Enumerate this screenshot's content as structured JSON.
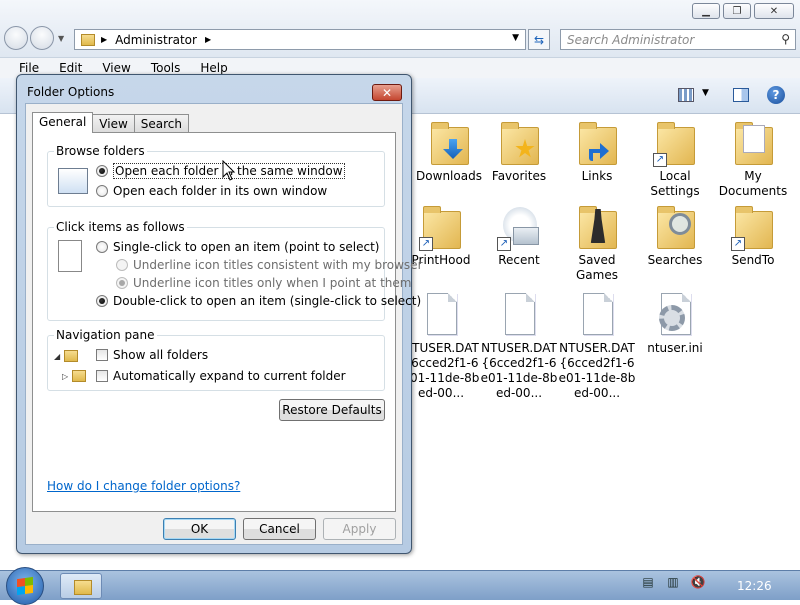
{
  "window": {
    "minimize_icon": "minimize-icon",
    "maximize_icon": "restore-icon",
    "close_icon": "close-icon"
  },
  "address_bar": {
    "path": "Administrator",
    "search_placeholder": "Search Administrator"
  },
  "menu": {
    "items": [
      "File",
      "Edit",
      "View",
      "Tools",
      "Help"
    ]
  },
  "files": [
    {
      "label": "Downloads",
      "type": "folder"
    },
    {
      "label": "Favorites",
      "type": "folder"
    },
    {
      "label": "Links",
      "type": "folder"
    },
    {
      "label": "Local Settings",
      "type": "folder-shortcut"
    },
    {
      "label": "My Documents",
      "type": "folder"
    },
    {
      "label": "PrintHood",
      "type": "folder-shortcut"
    },
    {
      "label": "Recent",
      "type": "shortcut"
    },
    {
      "label": "Saved Games",
      "type": "folder"
    },
    {
      "label": "Searches",
      "type": "folder"
    },
    {
      "label": "SendTo",
      "type": "folder-shortcut"
    },
    {
      "label": "NTUSER.DAT{6cced2f1-6e01-11de-8bed-00...",
      "type": "file"
    },
    {
      "label": "NTUSER.DAT{6cced2f1-6e01-11de-8bed-00...",
      "type": "file"
    },
    {
      "label": "NTUSER.DAT{6cced2f1-6e01-11de-8bed-00...",
      "type": "file"
    },
    {
      "label": "ntuser.ini",
      "type": "settings-file"
    }
  ],
  "dialog": {
    "title": "Folder Options",
    "tabs": [
      "General",
      "View",
      "Search"
    ],
    "browse_folders": {
      "title": "Browse folders",
      "opt_same": "Open each folder in the same window",
      "opt_own": "Open each folder in its own window"
    },
    "click_items": {
      "title": "Click items as follows",
      "single": "Single-click to open an item (point to select)",
      "underline_browser": "Underline icon titles consistent with my browser",
      "underline_point": "Underline icon titles only when I point at them",
      "double": "Double-click to open an item (single-click to select)"
    },
    "navigation_pane": {
      "title": "Navigation pane",
      "show_all": "Show all folders",
      "auto_expand": "Automatically expand to current folder"
    },
    "restore_defaults": "Restore Defaults",
    "help_link": "How do I change folder options?",
    "ok": "OK",
    "cancel": "Cancel",
    "apply": "Apply"
  },
  "taskbar": {
    "clock": "12:26"
  }
}
